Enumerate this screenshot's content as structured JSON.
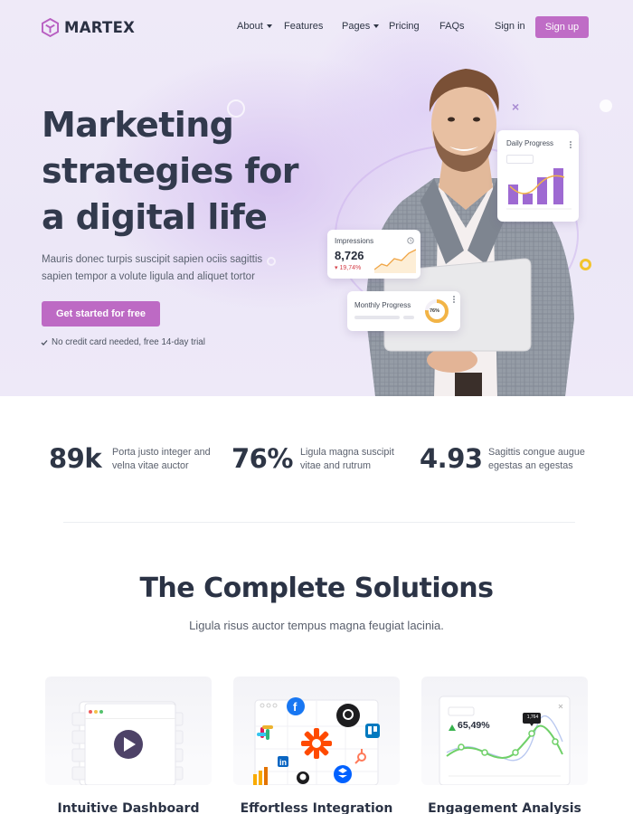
{
  "brand": {
    "name": "MARTEX",
    "accent": "#bf6cc6"
  },
  "nav": {
    "items": [
      {
        "label": "About",
        "dropdown": true
      },
      {
        "label": "Features",
        "dropdown": false
      },
      {
        "label": "Pages",
        "dropdown": true
      },
      {
        "label": "Pricing",
        "dropdown": false
      },
      {
        "label": "FAQs",
        "dropdown": false
      }
    ],
    "signin": "Sign in",
    "signup": "Sign up"
  },
  "hero": {
    "title_lines": [
      "Marketing",
      "strategies for",
      "a digital life"
    ],
    "description": "Mauris donec turpis suscipit sapien ociis sagittis sapien tempor a volute ligula and aliquet tortor",
    "cta": "Get started for free",
    "note": "No credit card needed, free 14-day trial"
  },
  "widgets": {
    "daily": {
      "title": "Daily Progress"
    },
    "impressions": {
      "title": "Impressions",
      "value": "8,726",
      "change": "19,74%"
    },
    "monthly": {
      "title": "Monthly Progress",
      "percent": "76%",
      "percent_value": 76
    }
  },
  "stats": [
    {
      "value": "89k",
      "text": "Porta justo integer and velna vitae auctor"
    },
    {
      "value": "76%",
      "text": "Ligula magna suscipit vitae and rutrum"
    },
    {
      "value": "4.93",
      "text": "Sagittis congue augue egestas an egestas"
    }
  ],
  "solutions": {
    "title": "The Complete Solutions",
    "subtitle": "Ligula risus auctor tempus magna feugiat lacinia.",
    "cards": [
      {
        "title": "Intuitive Dashboard"
      },
      {
        "title": "Effortless Integration"
      },
      {
        "title": "Engagement Analysis",
        "metric": "65,49%",
        "tooltip": "1,764"
      }
    ]
  }
}
